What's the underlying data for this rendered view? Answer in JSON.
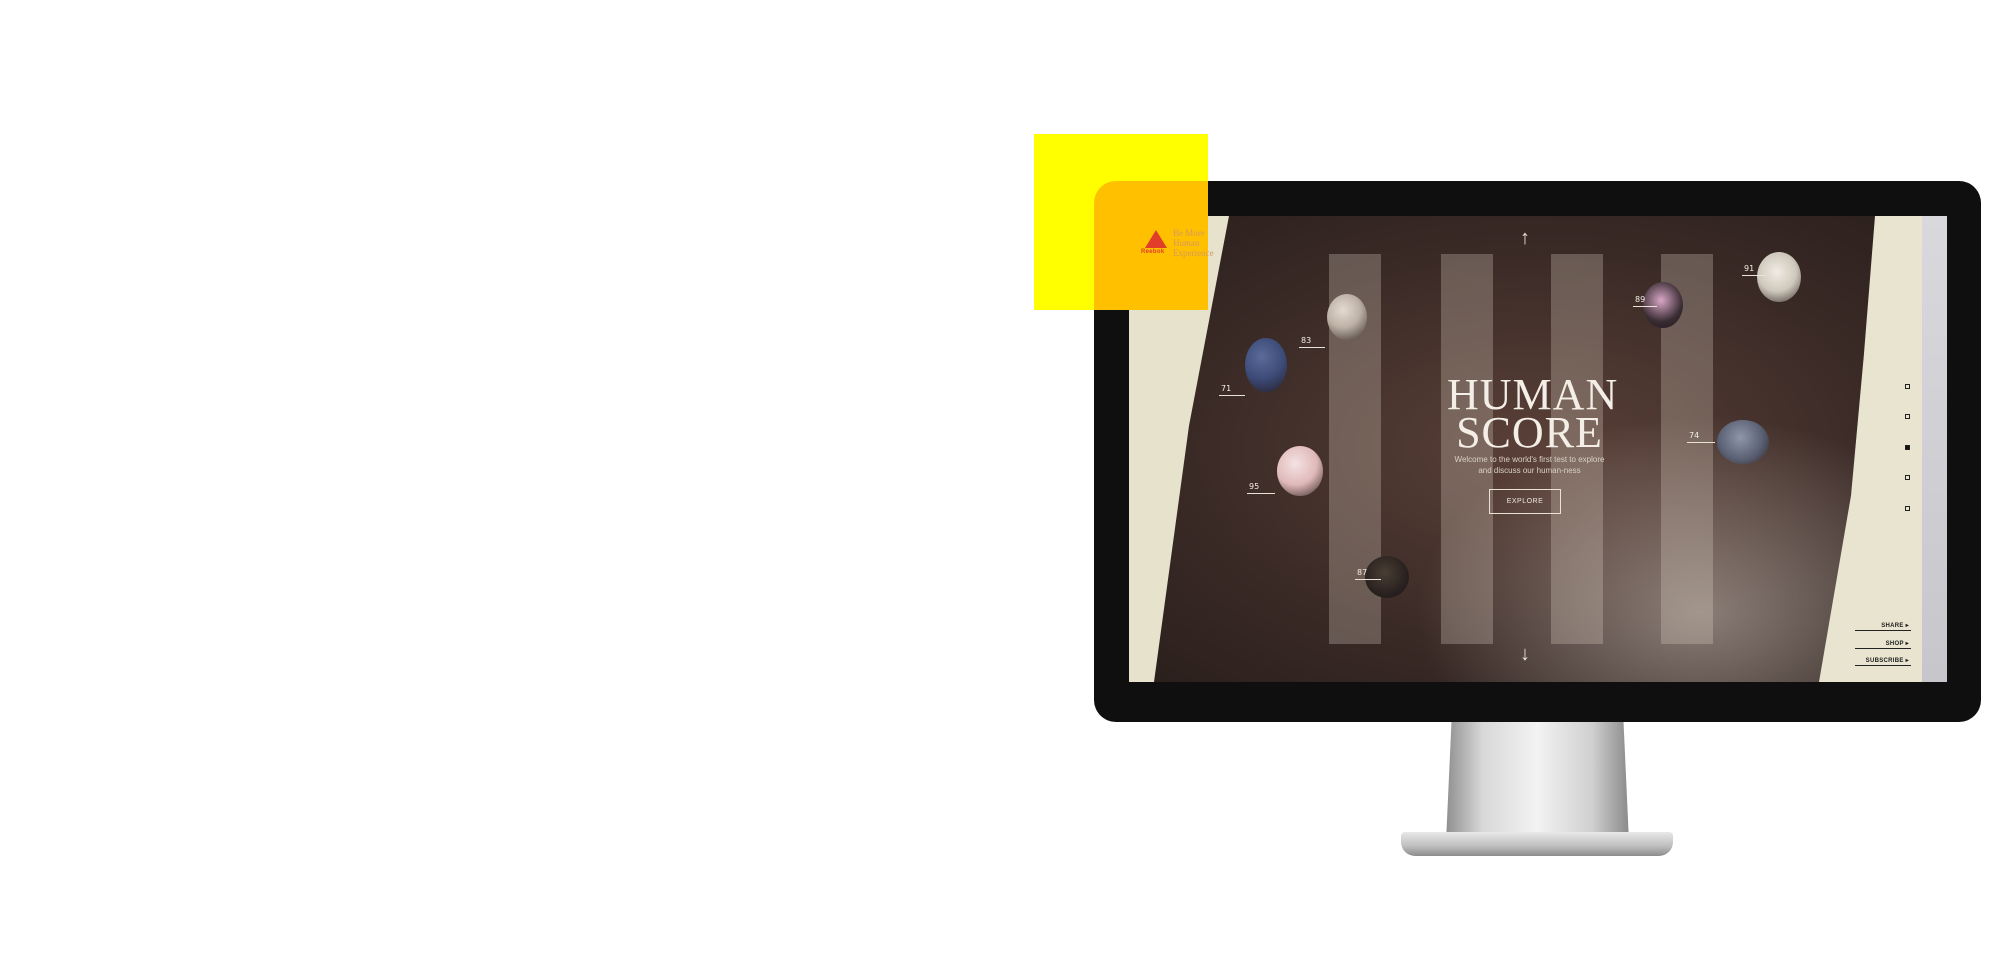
{
  "screen": {
    "logo": {
      "brand": "Reebok",
      "tagline": "Be More Human Experience"
    },
    "title_line1": "HUMAN",
    "title_line2": "SCORE",
    "subtitle_line1": "Welcome to the world's first test to explore",
    "subtitle_line2": "and discuss our human-ness",
    "explore_label": "EXPLORE",
    "scores": [
      "83",
      "71",
      "95",
      "87",
      "89",
      "91",
      "74"
    ],
    "nav_dots": 5,
    "active_dot_index": 2,
    "side_links": {
      "share": "SHARE ▸",
      "shop": "SHOP ▸",
      "subscribe": "SUBSCRIBE ▸"
    },
    "arrows": {
      "up": "↑",
      "down": "↓"
    }
  },
  "colors": {
    "yellow": "#ffff00",
    "orange": "#ffc000",
    "monitor": "#0f0f0f",
    "logo_red": "#e23c2a"
  }
}
